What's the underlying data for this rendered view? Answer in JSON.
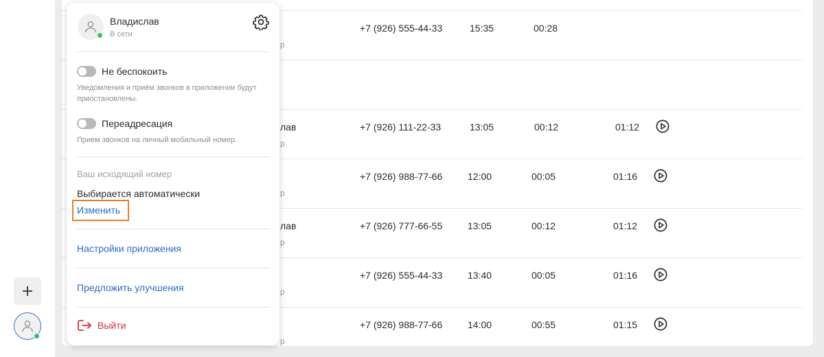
{
  "user": {
    "name": "Владислав",
    "status": "В сети"
  },
  "do_not_disturb": {
    "label": "Не беспокоить",
    "hint": "Уведомления и приём звонков в приложении будут приостановлены."
  },
  "forwarding": {
    "label": "Переадресация",
    "hint": "Прием звонков на личный мобильный номер."
  },
  "outgoing_number": {
    "title": "Ваш исходящий номер",
    "value": "Выбирается автоматически",
    "change_label": "Изменить"
  },
  "links": {
    "app_settings": "Настройки приложения",
    "suggest": "Предложить улучшения",
    "logout": "Выйти"
  },
  "colors": {
    "accent_link": "#2a6fc4",
    "highlight": "#f07c1b",
    "online": "#2ec26b",
    "logout": "#d32f3b"
  },
  "calls": [
    {
      "name_fragment": "",
      "sub_fragment": "р",
      "phone": "+7 (926) 555-44-33",
      "time": "15:35",
      "wait": "00:28",
      "duration": "",
      "has_play": false
    },
    {
      "name_fragment": "",
      "sub_fragment": "",
      "phone": "",
      "time": "",
      "wait": "",
      "duration": "",
      "has_play": false
    },
    {
      "name_fragment": "лав",
      "sub_fragment": "р",
      "phone": "+7 (926) 111-22-33",
      "time": "13:05",
      "wait": "00:12",
      "duration": "01:12",
      "has_play": true
    },
    {
      "name_fragment": "",
      "sub_fragment": "р",
      "phone": "+7 (926) 988-77-66",
      "time": "12:00",
      "wait": "00:05",
      "duration": "01:16",
      "has_play": true
    },
    {
      "name_fragment": "лав",
      "sub_fragment": "р",
      "phone": "+7 (926) 777-66-55",
      "time": "13:05",
      "wait": "00:12",
      "duration": "01:12",
      "has_play": true
    },
    {
      "name_fragment": "",
      "sub_fragment": "р",
      "phone": "+7 (926) 555-44-33",
      "time": "13:40",
      "wait": "00:05",
      "duration": "01:16",
      "has_play": true
    },
    {
      "name_fragment": "",
      "sub_fragment": "р",
      "phone": "+7 (926) 988-77-66",
      "time": "14:00",
      "wait": "00:55",
      "duration": "01:15",
      "has_play": true
    }
  ],
  "icons": {
    "add": "plus-icon",
    "avatar": "user-icon",
    "settings": "gear-icon",
    "play": "play-circle-icon",
    "logout": "logout-icon"
  }
}
